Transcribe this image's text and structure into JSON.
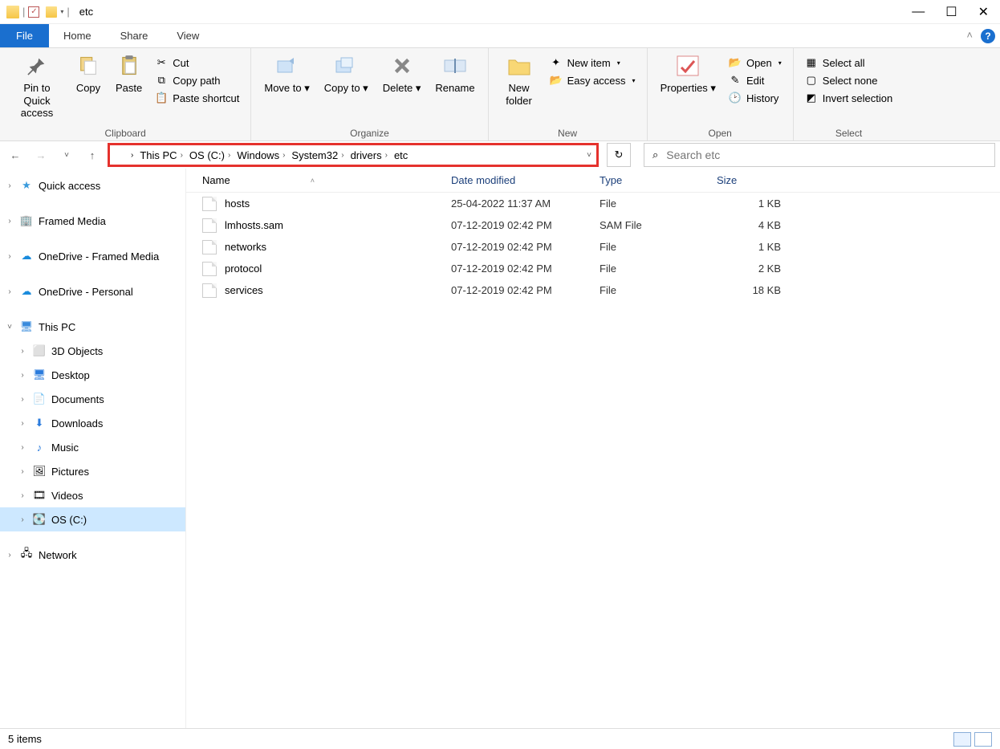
{
  "window": {
    "title": "etc"
  },
  "tabs": {
    "file": "File",
    "home": "Home",
    "share": "Share",
    "view": "View"
  },
  "ribbon": {
    "clipboard": {
      "label": "Clipboard",
      "pin": "Pin to Quick access",
      "copy": "Copy",
      "paste": "Paste",
      "cut": "Cut",
      "copy_path": "Copy path",
      "paste_shortcut": "Paste shortcut"
    },
    "organize": {
      "label": "Organize",
      "move_to": "Move to",
      "copy_to": "Copy to",
      "delete": "Delete",
      "rename": "Rename"
    },
    "new": {
      "label": "New",
      "new_folder": "New folder",
      "new_item": "New item",
      "easy_access": "Easy access"
    },
    "open": {
      "label": "Open",
      "properties": "Properties",
      "open": "Open",
      "edit": "Edit",
      "history": "History"
    },
    "select": {
      "label": "Select",
      "select_all": "Select all",
      "select_none": "Select none",
      "invert": "Invert selection"
    }
  },
  "breadcrumb": [
    "This PC",
    "OS (C:)",
    "Windows",
    "System32",
    "drivers",
    "etc"
  ],
  "search": {
    "placeholder": "Search etc"
  },
  "sidebar": {
    "quick_access": "Quick access",
    "framed_media": "Framed Media",
    "onedrive_fm": "OneDrive - Framed Media",
    "onedrive_personal": "OneDrive - Personal",
    "this_pc": "This PC",
    "objects_3d": "3D Objects",
    "desktop": "Desktop",
    "documents": "Documents",
    "downloads": "Downloads",
    "music": "Music",
    "pictures": "Pictures",
    "videos": "Videos",
    "osc": "OS (C:)",
    "network": "Network"
  },
  "columns": {
    "name": "Name",
    "date": "Date modified",
    "type": "Type",
    "size": "Size"
  },
  "files": [
    {
      "name": "hosts",
      "date": "25-04-2022 11:37 AM",
      "type": "File",
      "size": "1 KB"
    },
    {
      "name": "lmhosts.sam",
      "date": "07-12-2019 02:42 PM",
      "type": "SAM File",
      "size": "4 KB"
    },
    {
      "name": "networks",
      "date": "07-12-2019 02:42 PM",
      "type": "File",
      "size": "1 KB"
    },
    {
      "name": "protocol",
      "date": "07-12-2019 02:42 PM",
      "type": "File",
      "size": "2 KB"
    },
    {
      "name": "services",
      "date": "07-12-2019 02:42 PM",
      "type": "File",
      "size": "18 KB"
    }
  ],
  "status": {
    "items": "5 items"
  }
}
